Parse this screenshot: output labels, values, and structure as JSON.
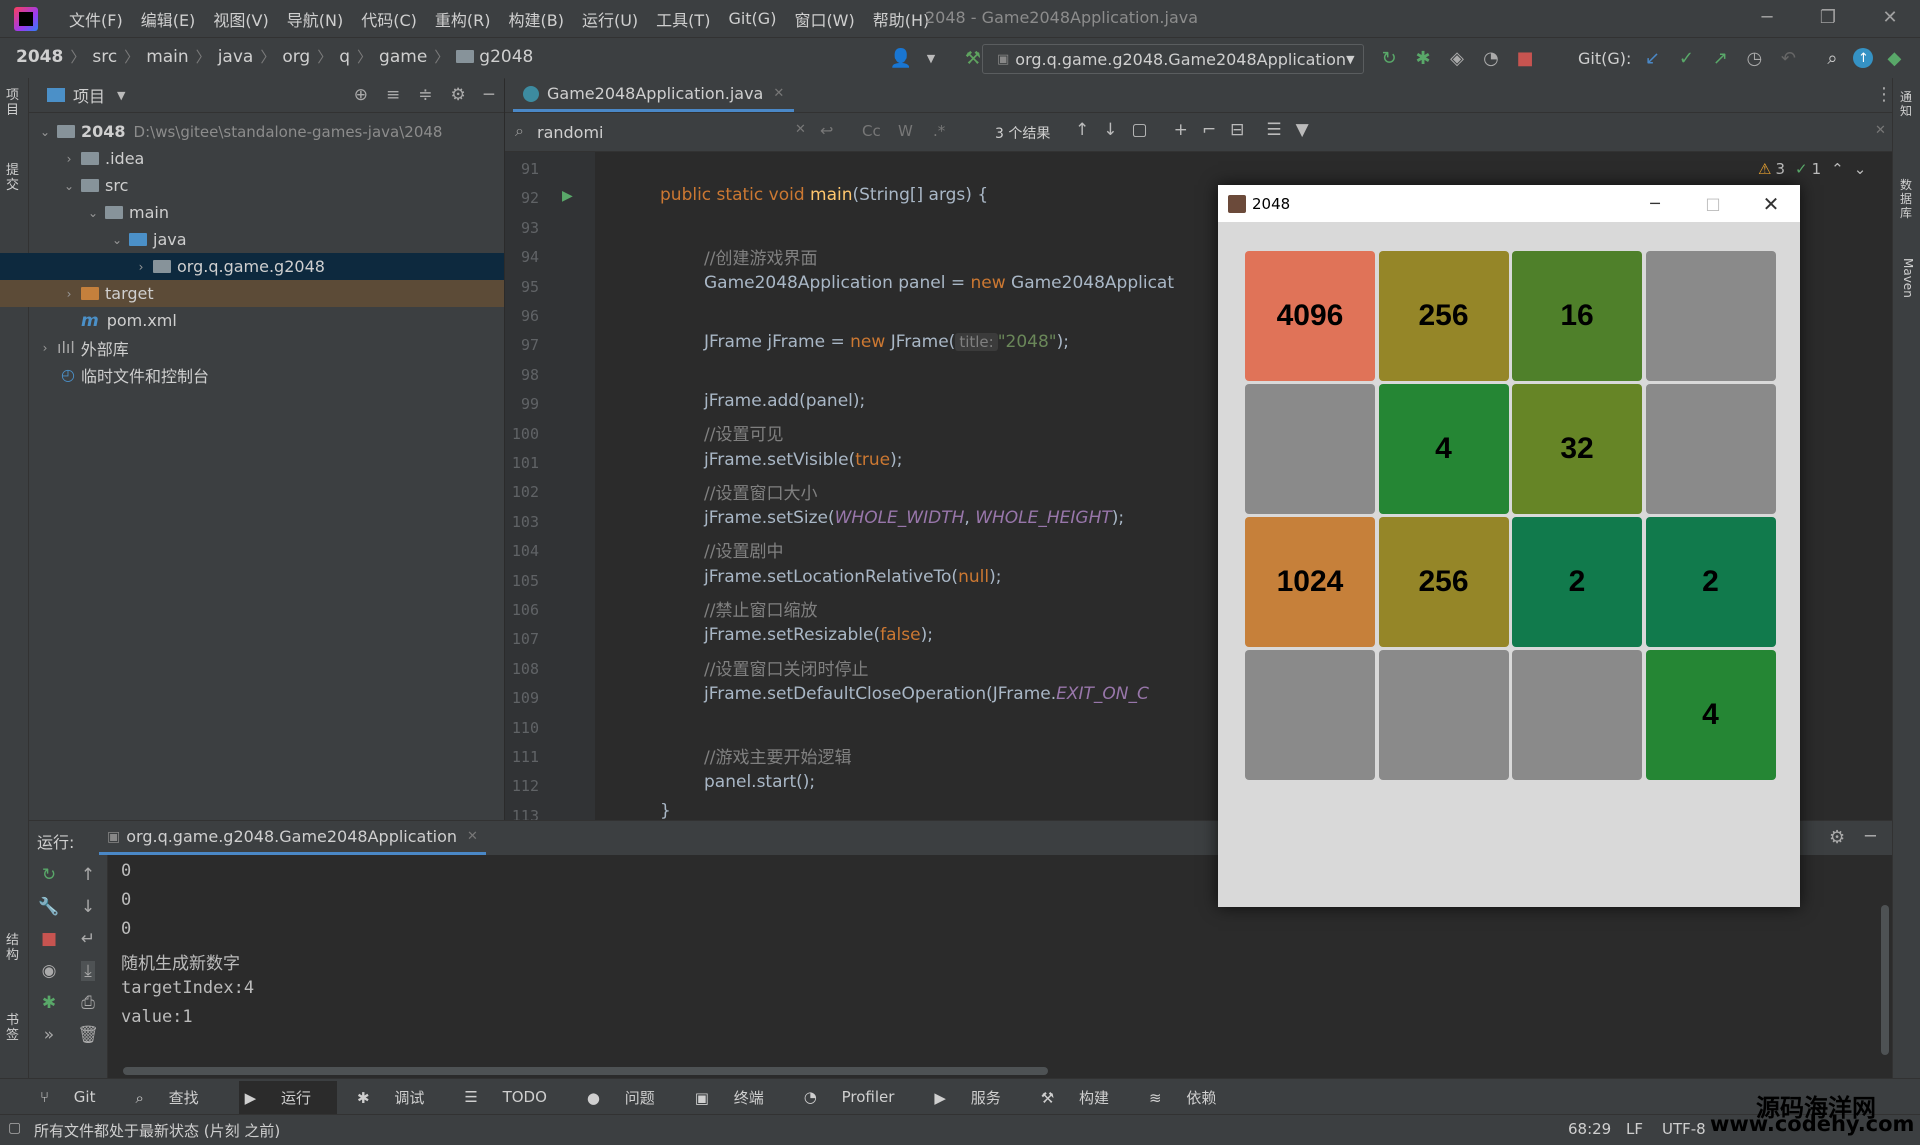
{
  "window": {
    "title": "2048 - Game2048Application.java"
  },
  "menu": [
    "文件(F)",
    "编辑(E)",
    "视图(V)",
    "导航(N)",
    "代码(C)",
    "重构(R)",
    "构建(B)",
    "运行(U)",
    "工具(T)",
    "Git(G)",
    "窗口(W)",
    "帮助(H)"
  ],
  "breadcrumb": [
    "2048",
    "src",
    "main",
    "java",
    "org",
    "q",
    "game",
    "g2048"
  ],
  "run_config": "org.q.game.g2048.Game2048Application",
  "git_label": "Git(G):",
  "project": {
    "header": "项目",
    "tree": [
      {
        "label": "2048",
        "path": "D:\\ws\\gitee\\standalone-games-java\\2048"
      },
      {
        "label": ".idea"
      },
      {
        "label": "src"
      },
      {
        "label": "main"
      },
      {
        "label": "java"
      },
      {
        "label": "org.q.game.g2048"
      },
      {
        "label": "target"
      },
      {
        "label": "pom.xml"
      },
      {
        "label": "外部库"
      },
      {
        "label": "临时文件和控制台"
      }
    ]
  },
  "editor": {
    "tab": "Game2048Application.java",
    "search": {
      "query": "randomi",
      "result": "3 个结果",
      "case_label": "Cc",
      "word_label": "W",
      "regex_label": ".*"
    },
    "inspections": {
      "warnings": "3",
      "ok": "1"
    },
    "lines": [
      "91",
      "92",
      "93",
      "94",
      "95",
      "96",
      "97",
      "98",
      "99",
      "100",
      "101",
      "102",
      "103",
      "104",
      "105",
      "106",
      "107",
      "108",
      "109",
      "110",
      "111",
      "112",
      "113"
    ],
    "code": {
      "l92": [
        "public static void ",
        "main",
        "(String[] args) {"
      ],
      "l94": "//创建游戏界面",
      "l95": [
        "Game2048Application panel = ",
        "new ",
        "Game2048Applicat"
      ],
      "l97": [
        "JFrame jFrame = ",
        "new ",
        "JFrame(",
        "title:",
        "\"2048\"",
        ");"
      ],
      "l99": "jFrame.add(panel);",
      "l100": "//设置可见",
      "l101": [
        "jFrame.setVisible(",
        "true",
        ");"
      ],
      "l102": "//设置窗口大小",
      "l103": [
        "jFrame.setSize(",
        "WHOLE_WIDTH",
        ", ",
        "WHOLE_HEIGHT",
        ");"
      ],
      "l104": "//设置剧中",
      "l105": [
        "jFrame.setLocationRelativeTo(",
        "null",
        ");"
      ],
      "l106": "//禁止窗口缩放",
      "l107": [
        "jFrame.setResizable(",
        "false",
        ");"
      ],
      "l108": "//设置窗口关闭时停止",
      "l109": [
        "jFrame.setDefaultCloseOperation(JFrame.",
        "EXIT_ON_C"
      ],
      "l111": "//游戏主要开始逻辑",
      "l112": "panel.start();",
      "l113": "}"
    }
  },
  "run": {
    "label": "运行:",
    "tab": "org.q.game.g2048.Game2048Application",
    "console": [
      "0",
      "0",
      "0",
      "随机生成新数字",
      "targetIndex:4",
      "value:1"
    ]
  },
  "toolwindows": [
    "Git",
    "查找",
    "运行",
    "调试",
    "TODO",
    "问题",
    "终端",
    "Profiler",
    "服务",
    "构建",
    "依赖"
  ],
  "status": {
    "message": "所有文件都处于最新状态 (片刻 之前)",
    "position": "68:29",
    "line_sep": "LF",
    "encoding": "UTF-8"
  },
  "right_strip": [
    "通知",
    "数据库",
    "Maven"
  ],
  "left_strip": [
    "项目",
    "提交",
    "结构",
    "书签"
  ],
  "game": {
    "title": "2048",
    "tiles": [
      [
        4096,
        256,
        16,
        0
      ],
      [
        0,
        4,
        32,
        0
      ],
      [
        1024,
        256,
        2,
        2
      ],
      [
        0,
        0,
        0,
        4
      ]
    ],
    "colors": {
      "0": "#8a8a8a",
      "2": "#117a4c",
      "4": "#258634",
      "16": "#4f802a",
      "32": "#668526",
      "256": "#958628",
      "1024": "#c6803a",
      "4096": "#e07358"
    }
  },
  "watermark": {
    "line1": "源码海洋网",
    "line2": "www.codehy.com"
  }
}
